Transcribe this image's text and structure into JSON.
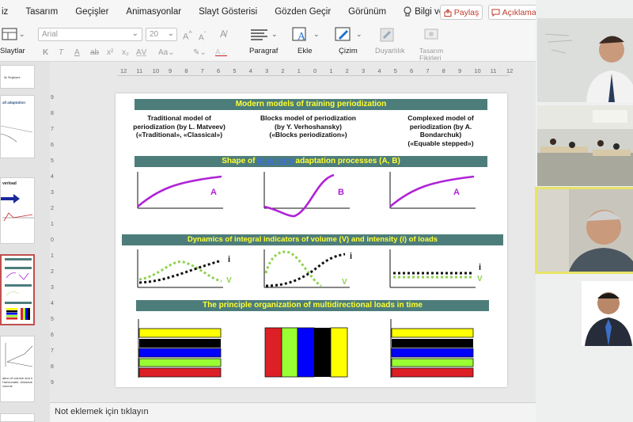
{
  "menubar": {
    "items": [
      "iz",
      "Tasarım",
      "Geçişler",
      "Animasyonlar",
      "Slayt Gösterisi",
      "Gözden Geçir",
      "Görünüm",
      "Bilgi ver"
    ],
    "share_label": "Paylaş",
    "comments_label": "Açıklamalar"
  },
  "ribbon": {
    "slides_label": "Slaytlar",
    "font_name": "Arial",
    "font_size": "20",
    "paragraph_label": "Paragraf",
    "insert_label": "Ekle",
    "draw_label": "Çizim",
    "sensitivity_label": "Duyarlılık",
    "designer_label": "Tasarım Fikirleri"
  },
  "thumbnails": {
    "t1_text": "ilç Segeyes",
    "t2_title": "all adaptation",
    "t3_title": "verload",
    "t5_text": "ation of volume and s Harizonatle, classical volume"
  },
  "ruler": {
    "top_ticks": [
      "12",
      "11",
      "10",
      "9",
      "8",
      "7",
      "6",
      "5",
      "4",
      "3",
      "2",
      "1",
      "0",
      "1",
      "2",
      "3",
      "4",
      "5",
      "6",
      "7",
      "8",
      "9",
      "10",
      "11",
      "12"
    ],
    "left_ticks": [
      "9",
      "8",
      "7",
      "6",
      "5",
      "4",
      "3",
      "2",
      "1",
      "0",
      "1",
      "2",
      "3",
      "4",
      "5",
      "6",
      "7",
      "8",
      "9"
    ]
  },
  "slide": {
    "banner1": "Modern  models of training periodization",
    "columns": [
      {
        "line1": "Traditional model of",
        "line2": "periodization (by L. Matveev)",
        "line3": "(«Traditional», «Classical»)",
        "line4": ""
      },
      {
        "line1": "Blocks model of  periodization",
        "line2": "(by Y. Verhoshansky)",
        "line3": "(«Blocks periodization»)",
        "line4": ""
      },
      {
        "line1": "Complexed model of",
        "line2": "periodization (by A.",
        "line3": "Bondarchuk)",
        "line4": "(«Equable stepped»)"
      }
    ],
    "banner2_pre": "Shape of ",
    "banner2_link": "long term",
    "banner2_post": " adaptation processes (A, B)",
    "curve_labels": [
      "A",
      "B",
      "A"
    ],
    "banner3": "Dynamics of integral indicators of volume (V) and intensity (i) of loads",
    "intensity_label": "i",
    "volume_label": "V",
    "banner4": "The principle organization of multidirectional loads in time",
    "colors": {
      "banner_bg": "#4d7d7b",
      "banner_text": "#ffff33",
      "curve": "#b022d8",
      "volume_dots": "#8fd14f",
      "intensity_dots": "#111111",
      "yellow": "#ffff00",
      "black": "#000000",
      "blue": "#0000ff",
      "green": "#99ff33",
      "red": "#dd1f26"
    }
  },
  "notes": {
    "placeholder": "Not eklemek için tıklayın"
  }
}
